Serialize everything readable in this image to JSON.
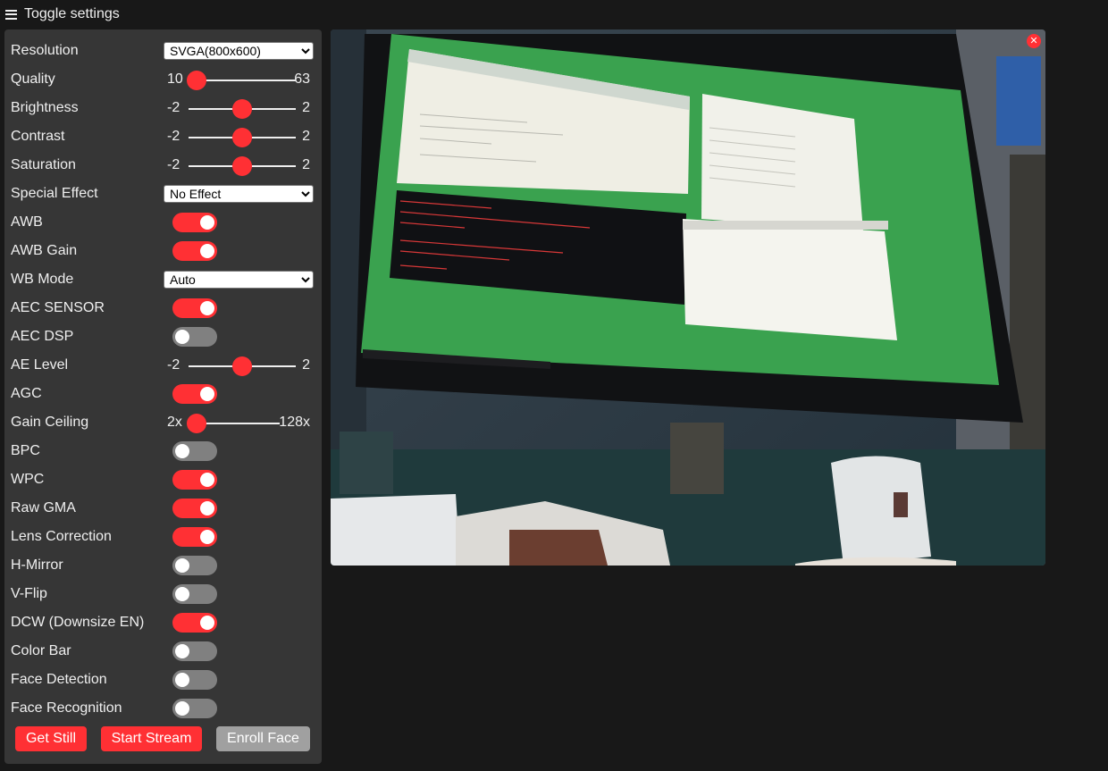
{
  "header": {
    "toggle_label": "Toggle settings",
    "icon": "hamburger-icon"
  },
  "settings": [
    {
      "id": "framesize",
      "label": "Resolution",
      "type": "select",
      "value": "SVGA(800x600)"
    },
    {
      "id": "quality",
      "label": "Quality",
      "type": "range",
      "min": "10",
      "max": "63",
      "value": 10,
      "vmin": 10,
      "vmax": 63
    },
    {
      "id": "brightness",
      "label": "Brightness",
      "type": "range",
      "min": "-2",
      "max": "2",
      "value": 0,
      "vmin": -2,
      "vmax": 2
    },
    {
      "id": "contrast",
      "label": "Contrast",
      "type": "range",
      "min": "-2",
      "max": "2",
      "value": 0,
      "vmin": -2,
      "vmax": 2
    },
    {
      "id": "saturation",
      "label": "Saturation",
      "type": "range",
      "min": "-2",
      "max": "2",
      "value": 0,
      "vmin": -2,
      "vmax": 2
    },
    {
      "id": "special_effect",
      "label": "Special Effect",
      "type": "select",
      "value": "No Effect"
    },
    {
      "id": "awb",
      "label": "AWB",
      "type": "toggle",
      "on": true
    },
    {
      "id": "awb_gain",
      "label": "AWB Gain",
      "type": "toggle",
      "on": true
    },
    {
      "id": "wb_mode",
      "label": "WB Mode",
      "type": "select",
      "value": "Auto"
    },
    {
      "id": "aec",
      "label": "AEC SENSOR",
      "type": "toggle",
      "on": true
    },
    {
      "id": "aec2",
      "label": "AEC DSP",
      "type": "toggle",
      "on": false
    },
    {
      "id": "ae_level",
      "label": "AE Level",
      "type": "range",
      "min": "-2",
      "max": "2",
      "value": 0,
      "vmin": -2,
      "vmax": 2
    },
    {
      "id": "agc",
      "label": "AGC",
      "type": "toggle",
      "on": true
    },
    {
      "id": "gainceiling",
      "label": "Gain Ceiling",
      "type": "range",
      "min": "2x",
      "max": "128x",
      "value": 0,
      "vmin": 0,
      "vmax": 6,
      "wide": true
    },
    {
      "id": "bpc",
      "label": "BPC",
      "type": "toggle",
      "on": false
    },
    {
      "id": "wpc",
      "label": "WPC",
      "type": "toggle",
      "on": true
    },
    {
      "id": "raw_gma",
      "label": "Raw GMA",
      "type": "toggle",
      "on": true
    },
    {
      "id": "lenc",
      "label": "Lens Correction",
      "type": "toggle",
      "on": true
    },
    {
      "id": "hmirror",
      "label": "H-Mirror",
      "type": "toggle",
      "on": false
    },
    {
      "id": "vflip",
      "label": "V-Flip",
      "type": "toggle",
      "on": false
    },
    {
      "id": "dcw",
      "label": "DCW (Downsize EN)",
      "type": "toggle",
      "on": true
    },
    {
      "id": "colorbar",
      "label": "Color Bar",
      "type": "toggle",
      "on": false
    },
    {
      "id": "face_detect",
      "label": "Face Detection",
      "type": "toggle",
      "on": false
    },
    {
      "id": "face_recognize",
      "label": "Face Recognition",
      "type": "toggle",
      "on": false
    }
  ],
  "buttons": [
    {
      "id": "get-still",
      "label": "Get Still",
      "enabled": true
    },
    {
      "id": "start-stream",
      "label": "Start Stream",
      "enabled": true
    },
    {
      "id": "enroll-face",
      "label": "Enroll Face",
      "enabled": false
    }
  ],
  "stream": {
    "close_icon": "close-icon",
    "close_glyph": "✕",
    "image_alt": "camera-stream-image"
  },
  "colors": {
    "accent": "#ff3034",
    "panel": "#363636",
    "background": "#181818",
    "toggle_off": "#808080",
    "disabled": "#a0a0a0"
  }
}
